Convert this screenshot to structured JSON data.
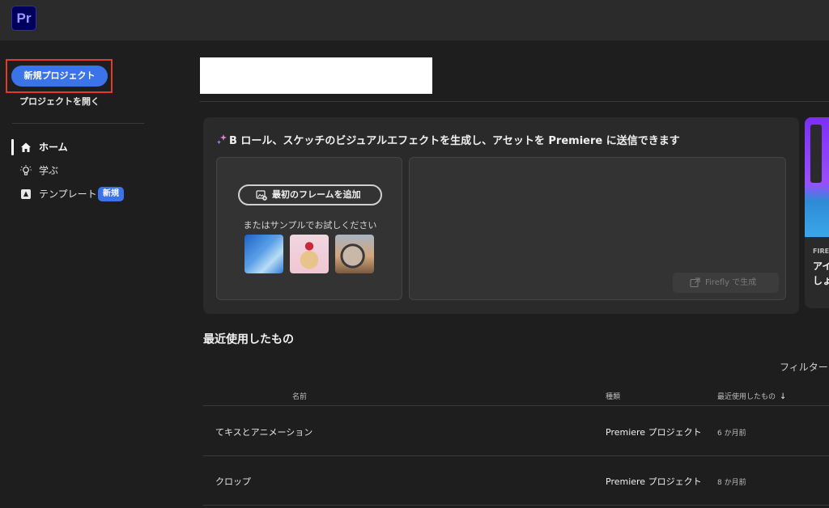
{
  "app": {
    "logo_text": "Pr",
    "accent": "#3b73e8"
  },
  "sidebar": {
    "new_project": "新規プロジェクト",
    "open_project": "プロジェクトを開く",
    "nav": [
      {
        "label": "ホーム",
        "icon": "home-icon",
        "active": true
      },
      {
        "label": "学ぶ",
        "icon": "lightbulb-icon",
        "active": false
      },
      {
        "label": "テンプレート",
        "icon": "template-icon",
        "active": false,
        "badge": "新規"
      }
    ]
  },
  "card": {
    "title": "B ロール、スケッチのビジュアルエフェクトを生成し、アセットを Premiere に送信できます",
    "add_first_frame": "最初のフレームを追加",
    "sample_text": "またはサンプルでお試しください",
    "samples": [
      "sample-sky-icon",
      "sample-pancake-icon",
      "sample-mirror-icon"
    ],
    "generate_button": "Firefly で生成"
  },
  "promo": {
    "tag": "FIRE",
    "line1": "アイ",
    "line2": "しょ"
  },
  "recent": {
    "title": "最近使用したもの",
    "filter": "フィルター",
    "columns": {
      "name": "名前",
      "type": "種類",
      "last_used": "最近使用したもの"
    },
    "rows": [
      {
        "name": "てキスとアニメーション",
        "type": "Premiere プロジェクト",
        "last_used": "6 か月前"
      },
      {
        "name": "クロップ",
        "type": "Premiere プロジェクト",
        "last_used": "8 か月前"
      }
    ]
  }
}
